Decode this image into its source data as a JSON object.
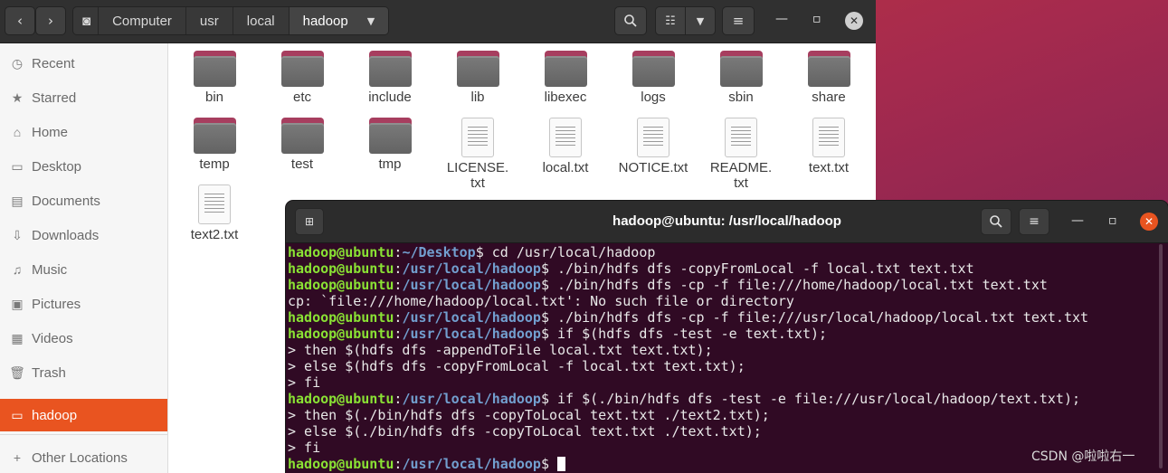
{
  "file_manager": {
    "breadcrumbs": [
      "Computer",
      "usr",
      "local",
      "hadoop"
    ],
    "sidebar": [
      {
        "label": "Recent",
        "icon": "clock-icon",
        "glyph": "◷"
      },
      {
        "label": "Starred",
        "icon": "star-icon",
        "glyph": "★"
      },
      {
        "label": "Home",
        "icon": "home-icon",
        "glyph": "⌂"
      },
      {
        "label": "Desktop",
        "icon": "desktop-icon",
        "glyph": "▭"
      },
      {
        "label": "Documents",
        "icon": "document-icon",
        "glyph": "▤"
      },
      {
        "label": "Downloads",
        "icon": "download-icon",
        "glyph": "⇩"
      },
      {
        "label": "Music",
        "icon": "music-icon",
        "glyph": "♫"
      },
      {
        "label": "Pictures",
        "icon": "picture-icon",
        "glyph": "▣"
      },
      {
        "label": "Videos",
        "icon": "video-icon",
        "glyph": "▦"
      },
      {
        "label": "Trash",
        "icon": "trash-icon",
        "glyph": "🗑"
      },
      {
        "label": "hadoop",
        "icon": "folder-icon",
        "glyph": "▭",
        "active": true
      },
      {
        "label": "Other Locations",
        "icon": "plus-icon",
        "glyph": "+"
      }
    ],
    "files": [
      {
        "name": "bin",
        "type": "folder"
      },
      {
        "name": "etc",
        "type": "folder"
      },
      {
        "name": "include",
        "type": "folder"
      },
      {
        "name": "lib",
        "type": "folder"
      },
      {
        "name": "libexec",
        "type": "folder"
      },
      {
        "name": "logs",
        "type": "folder"
      },
      {
        "name": "sbin",
        "type": "folder"
      },
      {
        "name": "share",
        "type": "folder"
      },
      {
        "name": "temp",
        "type": "folder"
      },
      {
        "name": "test",
        "type": "folder"
      },
      {
        "name": "tmp",
        "type": "folder"
      },
      {
        "name": "LICENSE.\ntxt",
        "type": "file"
      },
      {
        "name": "local.txt",
        "type": "file"
      },
      {
        "name": "NOTICE.txt",
        "type": "file"
      },
      {
        "name": "README.\ntxt",
        "type": "file"
      },
      {
        "name": "text.txt",
        "type": "file"
      },
      {
        "name": "text2.txt",
        "type": "file"
      }
    ]
  },
  "terminal": {
    "title": "hadoop@ubuntu: /usr/local/hadoop",
    "lines": [
      {
        "user": "hadoop@ubuntu",
        "path": "~/Desktop",
        "cmd": " cd /usr/local/hadoop"
      },
      {
        "user": "hadoop@ubuntu",
        "path": "/usr/local/hadoop",
        "cmd": " ./bin/hdfs dfs -copyFromLocal -f local.txt text.txt"
      },
      {
        "user": "hadoop@ubuntu",
        "path": "/usr/local/hadoop",
        "cmd": " ./bin/hdfs dfs -cp -f file:///home/hadoop/local.txt text.txt"
      },
      {
        "text": "cp: `file:///home/hadoop/local.txt': No such file or directory"
      },
      {
        "user": "hadoop@ubuntu",
        "path": "/usr/local/hadoop",
        "cmd": " ./bin/hdfs dfs -cp -f file:///usr/local/hadoop/local.txt text.txt"
      },
      {
        "user": "hadoop@ubuntu",
        "path": "/usr/local/hadoop",
        "cmd": " if $(hdfs dfs -test -e text.txt);"
      },
      {
        "text": "> then $(hdfs dfs -appendToFile local.txt text.txt);"
      },
      {
        "text": "> else $(hdfs dfs -copyFromLocal -f local.txt text.txt);"
      },
      {
        "text": "> fi"
      },
      {
        "user": "hadoop@ubuntu",
        "path": "/usr/local/hadoop",
        "cmd": " if $(./bin/hdfs dfs -test -e file:///usr/local/hadoop/text.txt);"
      },
      {
        "text": "> then $(./bin/hdfs dfs -copyToLocal text.txt ./text2.txt);"
      },
      {
        "text": "> else $(./bin/hdfs dfs -copyToLocal text.txt ./text.txt);"
      },
      {
        "text": "> fi"
      },
      {
        "user": "hadoop@ubuntu",
        "path": "/usr/local/hadoop",
        "cmd": " ",
        "cursor": true
      }
    ]
  },
  "watermark": "CSDN @啦啦右一"
}
